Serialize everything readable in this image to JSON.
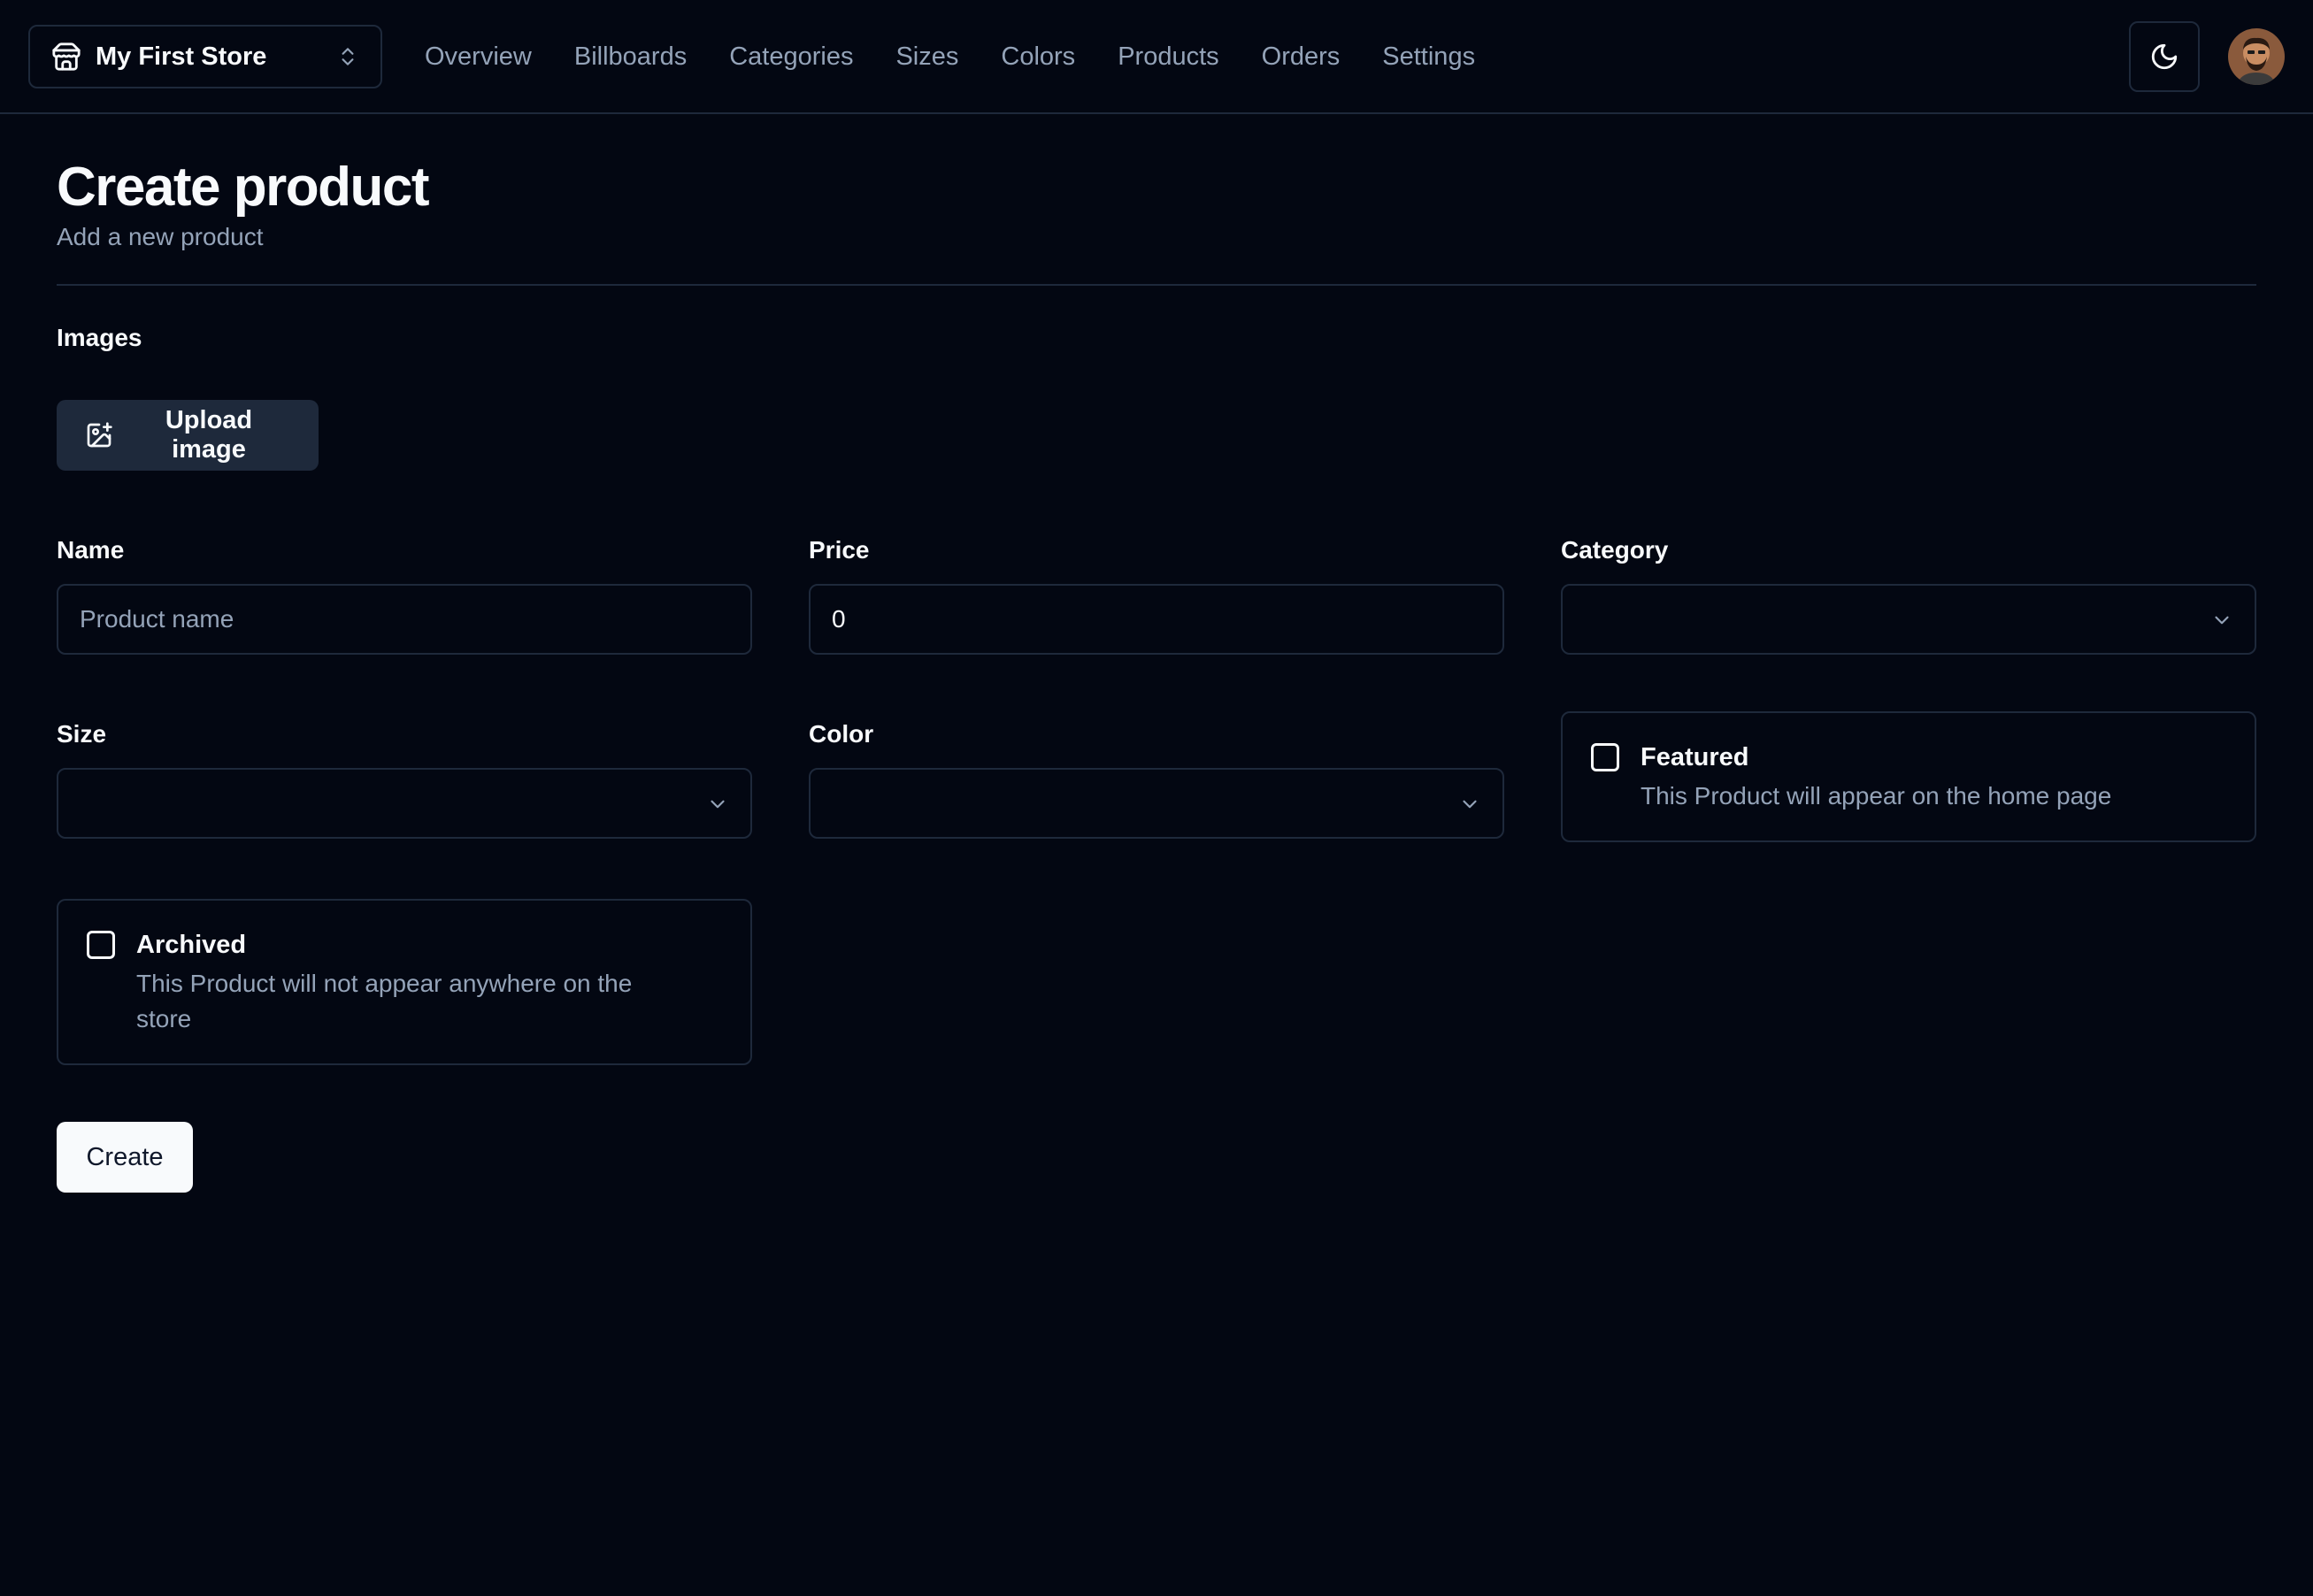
{
  "header": {
    "store_name": "My First Store",
    "nav": [
      {
        "label": "Overview"
      },
      {
        "label": "Billboards"
      },
      {
        "label": "Categories"
      },
      {
        "label": "Sizes"
      },
      {
        "label": "Colors"
      },
      {
        "label": "Products"
      },
      {
        "label": "Orders"
      },
      {
        "label": "Settings"
      }
    ],
    "icons": {
      "store": "store-icon",
      "switcher": "chevrons-up-down-icon",
      "theme": "moon-icon",
      "avatar": "user-avatar"
    }
  },
  "page": {
    "title": "Create product",
    "subtitle": "Add a new product"
  },
  "form": {
    "images_label": "Images",
    "upload_label": "Upload image",
    "name": {
      "label": "Name",
      "placeholder": "Product name",
      "value": ""
    },
    "price": {
      "label": "Price",
      "value": "0"
    },
    "category": {
      "label": "Category",
      "value": ""
    },
    "size": {
      "label": "Size",
      "value": ""
    },
    "color": {
      "label": "Color",
      "value": ""
    },
    "featured": {
      "label": "Featured",
      "description": "This Product will appear on the home page",
      "checked": false
    },
    "archived": {
      "label": "Archived",
      "description": "This Product will not appear anywhere on the store",
      "checked": false
    },
    "submit_label": "Create"
  },
  "colors": {
    "background": "#030712",
    "border": "#1e293b",
    "muted_text": "#94a3b8",
    "primary_button": "#f8fafc"
  }
}
